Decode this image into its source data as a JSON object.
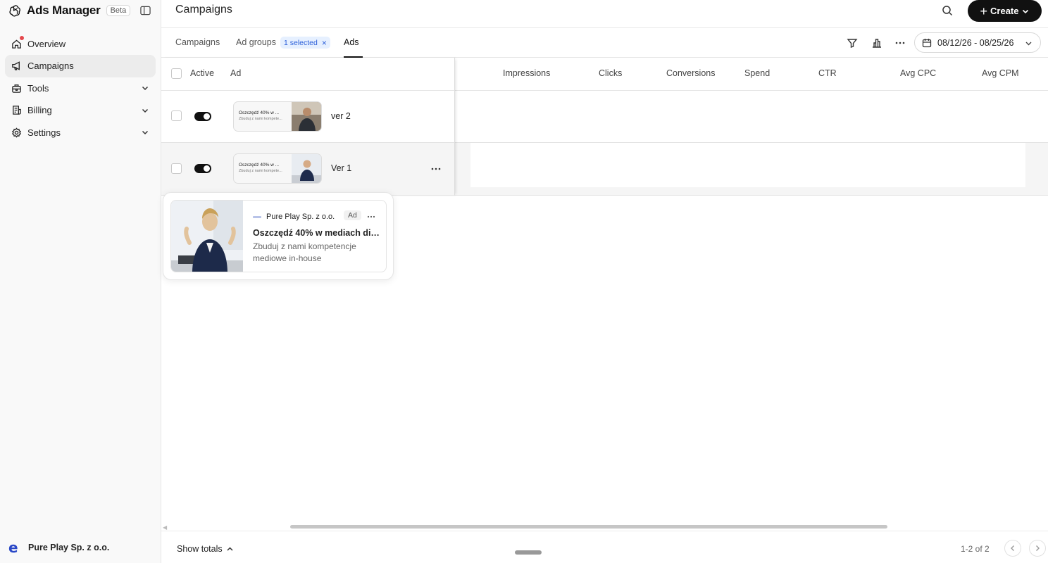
{
  "app": {
    "title": "Ads Manager",
    "badge": "Beta"
  },
  "sidebar": {
    "items": [
      {
        "label": "Overview",
        "icon": "home-icon"
      },
      {
        "label": "Campaigns",
        "icon": "megaphone-icon"
      },
      {
        "label": "Tools",
        "icon": "toolbox-icon"
      },
      {
        "label": "Billing",
        "icon": "receipt-icon"
      },
      {
        "label": "Settings",
        "icon": "gear-icon"
      }
    ],
    "org_name": "Pure Play Sp. z o.o.",
    "org_logo": "e"
  },
  "header": {
    "title": "Campaigns",
    "create_label": "Create"
  },
  "tabs": {
    "campaigns": "Campaigns",
    "ad_groups": "Ad groups",
    "selected_badge": "1 selected",
    "ads": "Ads",
    "date_range": "08/12/26 - 08/25/26"
  },
  "table": {
    "columns": [
      "Active",
      "Ad",
      "Impressions",
      "Clicks",
      "Conversions",
      "Spend",
      "CTR",
      "Avg CPC",
      "Avg CPM"
    ],
    "rows": [
      {
        "name": "ver 2",
        "thumb_headline": "Oszczędź 40% w ...",
        "thumb_desc": "Zbuduj z nami kompete...",
        "active": true
      },
      {
        "name": "Ver 1",
        "thumb_headline": "Oszczędź 40% w ...",
        "thumb_desc": "Zbuduj z nami kompete...",
        "active": true
      }
    ]
  },
  "preview": {
    "advertiser": "Pure Play Sp. z o.o.",
    "ad_label": "Ad",
    "headline": "Oszczędź 40% w mediach dig...",
    "description": "Zbuduj z nami kompetencje mediowe in-house"
  },
  "footer": {
    "show_totals": "Show totals",
    "pagination": "1-2 of 2"
  },
  "colors": {
    "accent": "#111111",
    "badge_bg": "#e6f0ff",
    "badge_text": "#2b5fd9",
    "notification": "#e5484d"
  }
}
